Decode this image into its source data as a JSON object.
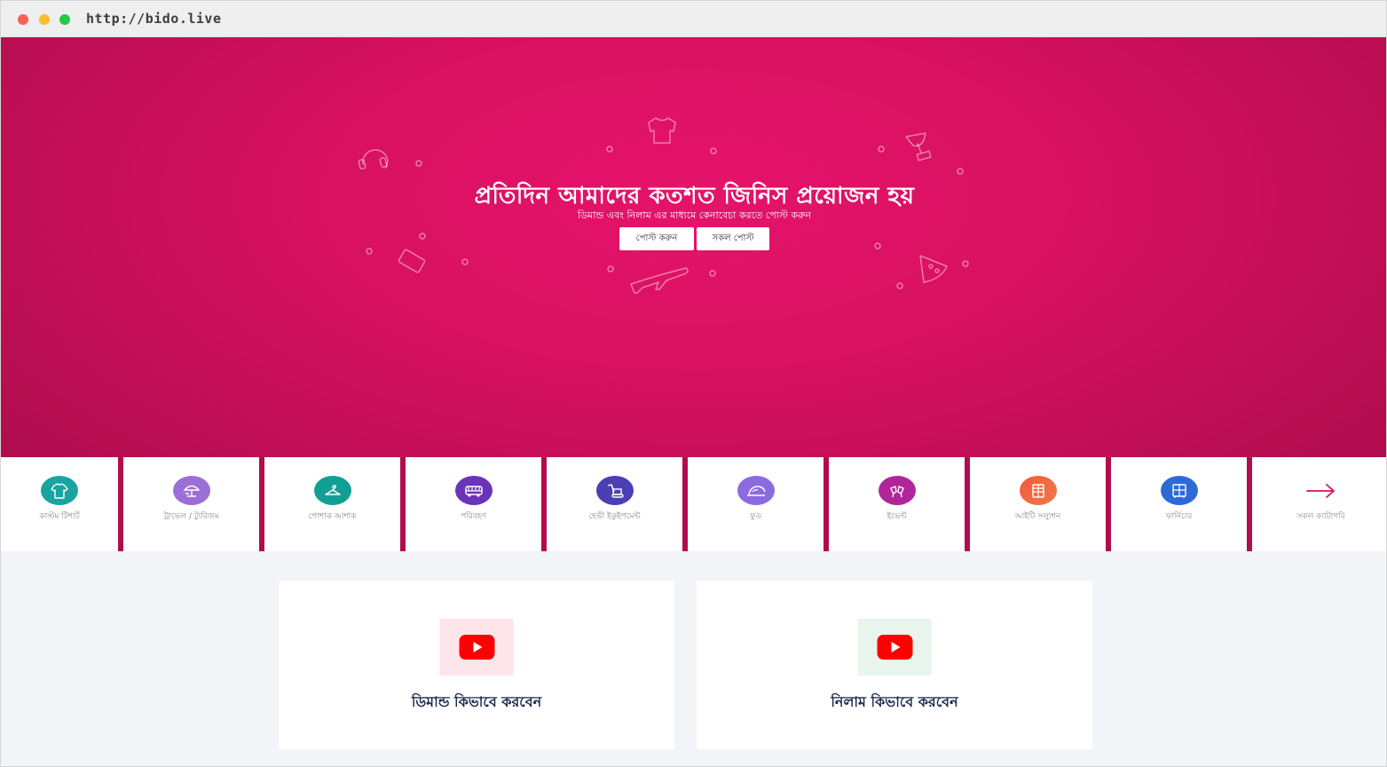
{
  "browser": {
    "url": "http://bido.live"
  },
  "hero": {
    "title": "প্রতিদিন আমাদের কতশত জিনিস প্রয়োজন হয়",
    "subtitle": "ডিমান্ড এবং নিলাম এর মাধ্যমে কেনাবেচা করতে পোস্ট করুন",
    "post_button": "পোস্ট করুন",
    "all_posts_button": "সকল পোস্ট",
    "background_color": "#d7115f"
  },
  "categories": [
    {
      "label": "কাস্টম টিশার্ট",
      "icon": "tshirt-icon",
      "color": "#1aa3a0"
    },
    {
      "label": "ট্রাভেল / ট্যুরিজম",
      "icon": "beach-umbrella-icon",
      "color": "#9b6fd6"
    },
    {
      "label": "পোশাক আশাক",
      "icon": "hanger-icon",
      "color": "#139e94"
    },
    {
      "label": "পরিবহণ",
      "icon": "bus-icon",
      "color": "#6a33b8"
    },
    {
      "label": "হেভী ইকুইপমেন্ট",
      "icon": "excavator-icon",
      "color": "#4a3fb4"
    },
    {
      "label": "ফুড",
      "icon": "food-cloche-icon",
      "color": "#8c6ae0"
    },
    {
      "label": "ইভেন্ট",
      "icon": "cheers-icon",
      "color": "#b0269a"
    },
    {
      "label": "আইটি সল্যুশন",
      "icon": "it-solution-icon",
      "color": "#f0573c"
    },
    {
      "label": "ফার্নিচার",
      "icon": "cabinet-icon",
      "color": "#2d6ad6"
    },
    {
      "label": "সকল ক্যাটাগরি",
      "icon": "arrow-right-icon",
      "color": "#d7115f"
    }
  ],
  "cards": [
    {
      "title": "ডিমান্ড কিভাবে করবেন",
      "icon": "youtube-play-icon"
    },
    {
      "title": "নিলাম কিভাবে করবেন",
      "icon": "youtube-play-icon"
    }
  ]
}
